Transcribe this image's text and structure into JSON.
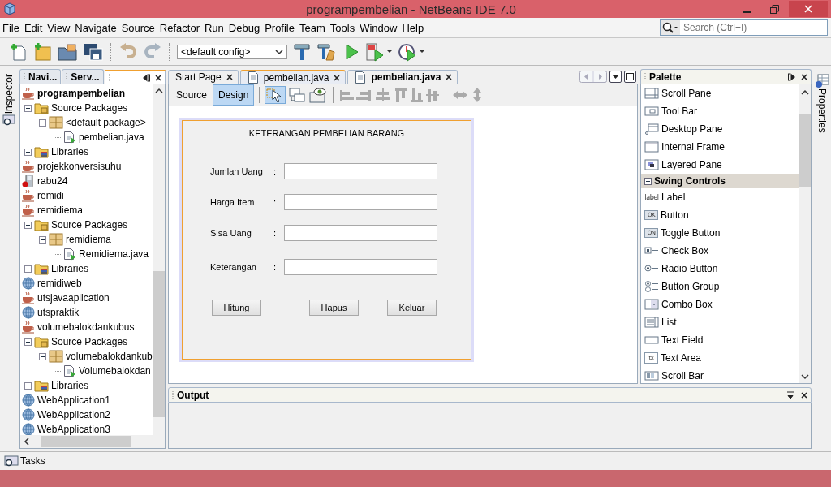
{
  "window": {
    "title": "programpembelian - NetBeans IDE 7.0"
  },
  "menu": [
    "File",
    "Edit",
    "View",
    "Navigate",
    "Source",
    "Refactor",
    "Run",
    "Debug",
    "Profile",
    "Team",
    "Tools",
    "Window",
    "Help"
  ],
  "search": {
    "placeholder": "Search (Ctrl+I)"
  },
  "toolbar": {
    "config": "<default config>"
  },
  "left_strip": {
    "label": "Inspector"
  },
  "project_tabs": [
    {
      "label": "Navi...",
      "selected": false
    },
    {
      "label": "Serv...",
      "selected": false
    }
  ],
  "tree": [
    {
      "label": "programpembelian",
      "kind": "project",
      "main": true,
      "children": [
        {
          "label": "Source Packages",
          "kind": "folder",
          "expanded": true,
          "children": [
            {
              "label": "<default package>",
              "kind": "package",
              "expanded": true,
              "children": [
                {
                  "label": "pembelian.java",
                  "kind": "file"
                }
              ]
            }
          ]
        },
        {
          "label": "Libraries",
          "kind": "libraries",
          "expanded": false
        }
      ]
    },
    {
      "label": "projekkonversisuhu",
      "kind": "project",
      "main": false
    },
    {
      "label": "rabu24",
      "kind": "mobile",
      "main": false
    },
    {
      "label": "remidi",
      "kind": "project",
      "main": false
    },
    {
      "label": "remidiema",
      "kind": "project",
      "main": false,
      "children": [
        {
          "label": "Source Packages",
          "kind": "folder",
          "expanded": true,
          "children": [
            {
              "label": "remidiema",
              "kind": "package",
              "expanded": true,
              "children": [
                {
                  "label": "Remidiema.java",
                  "kind": "file"
                }
              ]
            }
          ]
        },
        {
          "label": "Libraries",
          "kind": "libraries",
          "expanded": false
        }
      ]
    },
    {
      "label": "remidiweb",
      "kind": "web",
      "main": false
    },
    {
      "label": "utsjavaaplication",
      "kind": "project",
      "main": false
    },
    {
      "label": "utspraktik",
      "kind": "web",
      "main": false
    },
    {
      "label": "volumebalokdankubus",
      "kind": "project",
      "main": false,
      "children": [
        {
          "label": "Source Packages",
          "kind": "folder",
          "expanded": true,
          "children": [
            {
              "label": "volumebalokdankub",
              "kind": "package",
              "expanded": true,
              "children": [
                {
                  "label": "Volumebalokdan",
                  "kind": "file"
                }
              ]
            }
          ]
        },
        {
          "label": "Libraries",
          "kind": "libraries",
          "expanded": false
        }
      ]
    },
    {
      "label": "WebApplication1",
      "kind": "web",
      "main": false
    },
    {
      "label": "WebApplication2",
      "kind": "web",
      "main": false
    },
    {
      "label": "WebApplication3",
      "kind": "web",
      "main": false
    }
  ],
  "editor_tabs": [
    {
      "label": "Start Page",
      "kind": "page",
      "selected": false,
      "modified": false
    },
    {
      "label": "pembelian.java",
      "kind": "file",
      "selected": true,
      "modified": false
    },
    {
      "label": "pembelian.java",
      "kind": "file",
      "selected": false,
      "modified": true
    }
  ],
  "view_tabs": [
    {
      "label": "Source",
      "selected": false
    },
    {
      "label": "Design",
      "selected": true
    }
  ],
  "form": {
    "title": "KETERANGAN PEMBELIAN BARANG",
    "fields": [
      {
        "label": "Jumlah Uang",
        "colon": ":"
      },
      {
        "label": "Harga Item",
        "colon": ":"
      },
      {
        "label": "Sisa Uang",
        "colon": ":"
      },
      {
        "label": "Keterangan",
        "colon": ":"
      }
    ],
    "buttons": [
      "Hitung",
      "Hapus",
      "Keluar"
    ]
  },
  "palette": {
    "title": "Palette",
    "items": [
      {
        "label": "Scroll Pane",
        "kind": "scroll-pane"
      },
      {
        "label": "Tool Bar",
        "kind": "tool-bar"
      },
      {
        "label": "Desktop Pane",
        "kind": "desktop-pane"
      },
      {
        "label": "Internal Frame",
        "kind": "internal-frame"
      },
      {
        "label": "Layered Pane",
        "kind": "layered-pane"
      },
      {
        "label": "Swing Controls",
        "kind": "category",
        "expanded": true
      },
      {
        "label": "Label",
        "kind": "label",
        "icon_text": "label"
      },
      {
        "label": "Button",
        "kind": "button",
        "icon_text": "OK"
      },
      {
        "label": "Toggle Button",
        "kind": "toggle-button",
        "icon_text": "ON"
      },
      {
        "label": "Check Box",
        "kind": "check-box"
      },
      {
        "label": "Radio Button",
        "kind": "radio-button"
      },
      {
        "label": "Button Group",
        "kind": "button-group"
      },
      {
        "label": "Combo Box",
        "kind": "combo-box"
      },
      {
        "label": "List",
        "kind": "list"
      },
      {
        "label": "Text Field",
        "kind": "text-field"
      },
      {
        "label": "Text Area",
        "kind": "text-area",
        "icon_text": "tx"
      },
      {
        "label": "Scroll Bar",
        "kind": "scroll-bar"
      }
    ]
  },
  "right_strip": {
    "label": "Properties"
  },
  "output": {
    "title": "Output"
  },
  "status_bar": {
    "tasks": "Tasks"
  }
}
